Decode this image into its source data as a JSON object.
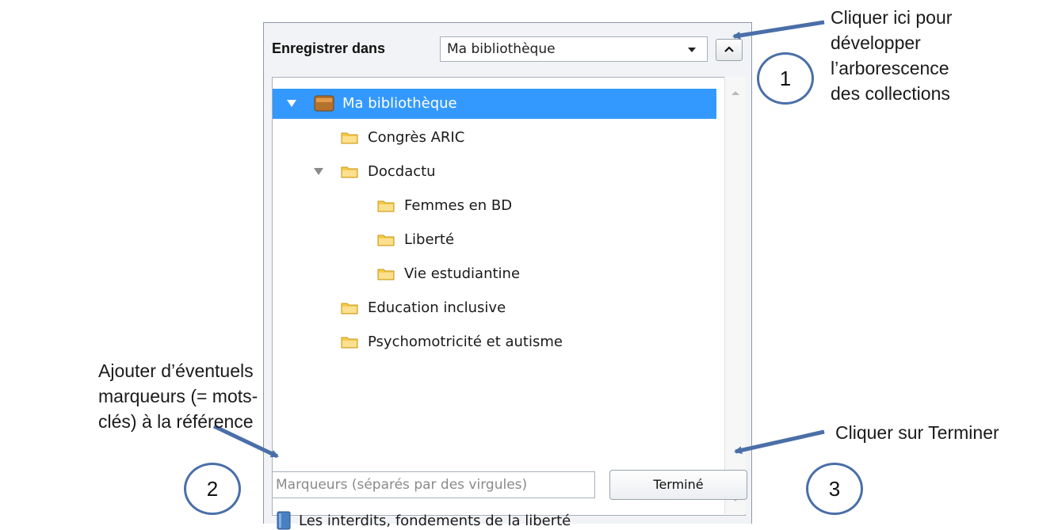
{
  "panel": {
    "save_in_label": "Enregistrer dans",
    "dropdown_value": "Ma bibliothèque",
    "tree": [
      {
        "label": "Ma bibliothèque",
        "level": 0,
        "expanded": true,
        "type": "library",
        "selected": true
      },
      {
        "label": "Congrès ARIC",
        "level": 1,
        "type": "folder"
      },
      {
        "label": "Docdactu",
        "level": 1,
        "expanded": true,
        "type": "folder"
      },
      {
        "label": "Femmes en BD",
        "level": 2,
        "type": "folder"
      },
      {
        "label": "Liberté",
        "level": 2,
        "type": "folder"
      },
      {
        "label": "Vie estudiantine",
        "level": 2,
        "type": "folder"
      },
      {
        "label": "Education inclusive",
        "level": 1,
        "type": "folder"
      },
      {
        "label": "Psychomotricité et autisme",
        "level": 1,
        "type": "folder"
      }
    ],
    "markers_placeholder": "Marqueurs (séparés par des virgules)",
    "done_label": "Terminé",
    "item_title": "Les interdits, fondements de la liberté"
  },
  "annotations": {
    "one": {
      "number": "1",
      "lines": [
        "Cliquer ici pour",
        "développer",
        "l’arborescence",
        "des collections"
      ]
    },
    "two": {
      "number": "2",
      "lines": [
        "Ajouter d’éventuels",
        "marqueurs (= mots-",
        "clés) à la référence"
      ]
    },
    "three": {
      "number": "3",
      "lines": [
        "Cliquer sur Terminer"
      ]
    }
  },
  "colors": {
    "accent": "#4a6fa8",
    "selection": "#3399ff",
    "folder": "#f5c94a"
  }
}
